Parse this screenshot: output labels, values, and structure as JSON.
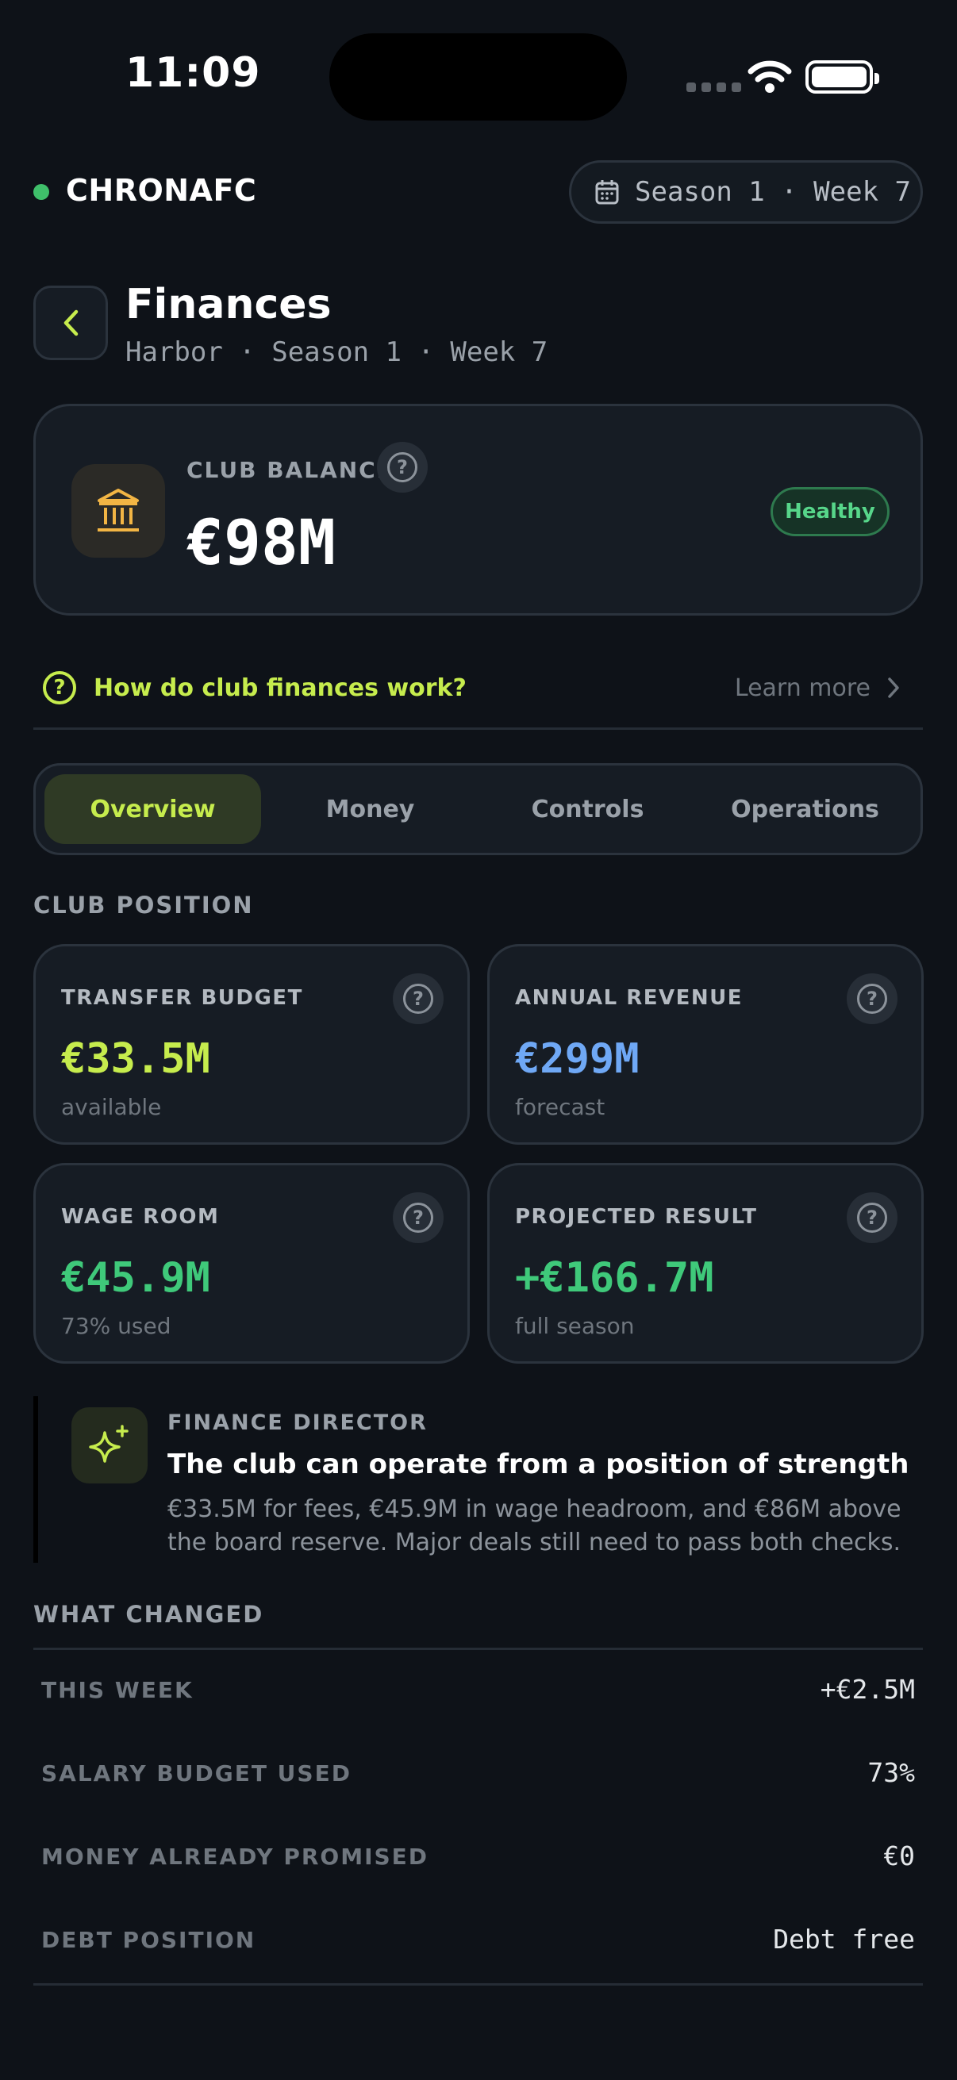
{
  "status_bar": {
    "time": "11:09"
  },
  "header": {
    "brand": "CHRONAFC",
    "season_label": "Season 1 · Week 7"
  },
  "page": {
    "title": "Finances",
    "subtitle": "Harbor · Season 1 · Week 7"
  },
  "balance": {
    "label": "CLUB BALANCE",
    "value": "€98M",
    "status": "Healthy"
  },
  "info": {
    "question": "How do club finances work?",
    "learn_more": "Learn more"
  },
  "tabs": [
    {
      "label": "Overview",
      "active": true
    },
    {
      "label": "Money",
      "active": false
    },
    {
      "label": "Controls",
      "active": false
    },
    {
      "label": "Operations",
      "active": false
    }
  ],
  "club_position": {
    "label": "CLUB POSITION",
    "cards": [
      {
        "title": "TRANSFER BUDGET",
        "value": "€33.5M",
        "sub": "available",
        "color": "#c6ec4d"
      },
      {
        "title": "ANNUAL REVENUE",
        "value": "€299M",
        "sub": "forecast",
        "color": "#6fa8f5"
      },
      {
        "title": "WAGE ROOM",
        "value": "€45.9M",
        "sub": "73% used",
        "color": "#3fc97a"
      },
      {
        "title": "PROJECTED RESULT",
        "value": "+€166.7M",
        "sub": "full season",
        "color": "#3fc97a"
      }
    ]
  },
  "director": {
    "label": "FINANCE DIRECTOR",
    "headline": "The club can operate from a position of strength",
    "body": "€33.5M for fees, €45.9M in wage headroom, and €86M above the board reserve. Major deals still need to pass both checks."
  },
  "what_changed": {
    "label": "WHAT CHANGED",
    "rows": [
      {
        "key": "THIS WEEK",
        "value": "+€2.5M"
      },
      {
        "key": "SALARY BUDGET USED",
        "value": "73%"
      },
      {
        "key": "MONEY ALREADY PROMISED",
        "value": "€0"
      },
      {
        "key": "DEBT POSITION",
        "value": "Debt free"
      }
    ]
  },
  "colors": {
    "accent": "#c6ec4d",
    "positive": "#3fc97a",
    "revenue": "#6fa8f5",
    "bank_icon": "#f2b544"
  }
}
